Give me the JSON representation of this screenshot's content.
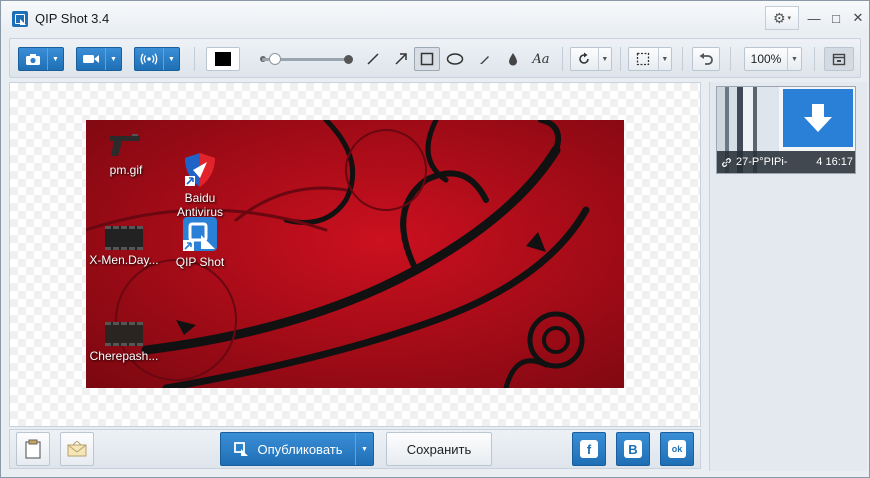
{
  "window": {
    "title": "QIP Shot 3.4"
  },
  "titlebar": {
    "gear_caret": "▾",
    "minimize": "—",
    "maximize": "□",
    "close": "✕"
  },
  "toolbar": {
    "color": "#000000",
    "line_width_fraction": 0.15,
    "zoom": "100%",
    "text_tool_glyph": "Aa"
  },
  "screenshot": {
    "background_color": "#b00c18",
    "icons": [
      {
        "label": "pm.gif",
        "icon": "pistol-icon"
      },
      {
        "label": "Baidu\nAntivirus",
        "icon": "baidu-antivirus-icon"
      },
      {
        "label": "X-Men.Day...",
        "icon": "video-icon"
      },
      {
        "label": "QIP Shot",
        "icon": "qip-shot-icon"
      },
      {
        "label": "Cherepash...",
        "icon": "video-icon"
      }
    ]
  },
  "bottombar": {
    "publish_label": "Опубликовать",
    "save_label": "Сохранить",
    "social": [
      {
        "name": "facebook",
        "glyph": "f"
      },
      {
        "name": "vkontakte",
        "glyph": "B"
      },
      {
        "name": "odnoklassniki",
        "glyph": "ok"
      }
    ]
  },
  "history": {
    "items": [
      {
        "name": "27-P°PIPi-",
        "time": "4 16:17"
      }
    ]
  },
  "colors": {
    "accent": "#1f6fb5",
    "accent_light": "#3a8fd6",
    "panel": "#e4e9ef"
  }
}
